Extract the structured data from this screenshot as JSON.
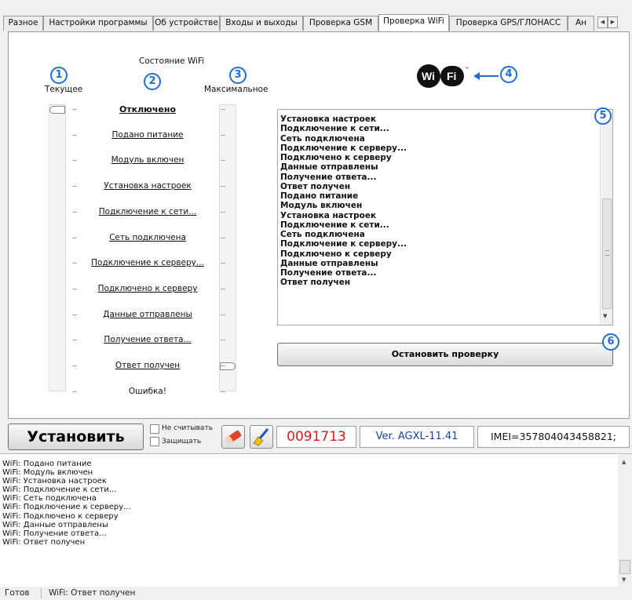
{
  "tabs": [
    {
      "label": "Разное",
      "active": false
    },
    {
      "label": "Настройки программы",
      "active": false
    },
    {
      "label": "Об устройстве",
      "active": false
    },
    {
      "label": "Входы и выходы",
      "active": false
    },
    {
      "label": "Проверка GSM",
      "active": false
    },
    {
      "label": "Проверка WiFi",
      "active": true
    },
    {
      "label": "Проверка GPS/ГЛОНАСС",
      "active": false
    },
    {
      "label": "Ан",
      "active": false
    }
  ],
  "wifi": {
    "group_title": "Состояние WiFi",
    "columns": {
      "current": "Текущее",
      "max": "Максимальное"
    },
    "callouts": [
      "1",
      "2",
      "3",
      "4",
      "5",
      "6"
    ],
    "logo_text": "Wi Fi",
    "states": [
      "Отключено",
      "Подано питание",
      "Модуль включен",
      "Установка настроек",
      "Подключение к сети...",
      "Сеть подключена",
      "Подключение к серверу...",
      "Подключено к серверу",
      "Данные отправлены",
      "Получение ответа...",
      "Ответ получен",
      "Ошибка!"
    ],
    "current_index": 0,
    "max_index": 10,
    "log_lines": [
      "Установка настроек",
      "Подключение к сети...",
      "Сеть подключена",
      "Подключение к серверу...",
      "Подключено к серверу",
      "Данные отправлены",
      "Получение ответа...",
      "Ответ получен",
      "Подано питание",
      "Модуль включен",
      "Установка настроек",
      "Подключение к сети...",
      "Сеть подключена",
      "Подключение к серверу...",
      "Подключено к серверу",
      "Данные отправлены",
      "Получение ответа...",
      "Ответ получен"
    ],
    "stop_label": "Остановить проверку"
  },
  "toolbar": {
    "install_label": "Установить",
    "no_read_label": "Не считывать",
    "protect_label": "Защищать",
    "eraser_icon": "eraser-icon",
    "broom_icon": "broom-icon",
    "serial": "0091713",
    "version": "Ver. AGXL-11.41",
    "imei": "IMEI=357804043458821;",
    "colors": {
      "serial": "#e0161b",
      "version": "#1d3f9e"
    }
  },
  "log": [
    "WiFi: Подано питание",
    "WiFi: Модуль включен",
    "WiFi: Установка настроек",
    "WiFi: Подключение к сети...",
    "WiFi: Сеть подключена",
    "WiFi: Подключение к серверу...",
    "WiFi: Подключено к серверу",
    "WiFi: Данные отправлены",
    "WiFi: Получение ответа...",
    "WiFi: Ответ получен"
  ],
  "status": {
    "ready": "Готов",
    "message": "WiFi: Ответ получен"
  },
  "accent": "#1f6fd1"
}
